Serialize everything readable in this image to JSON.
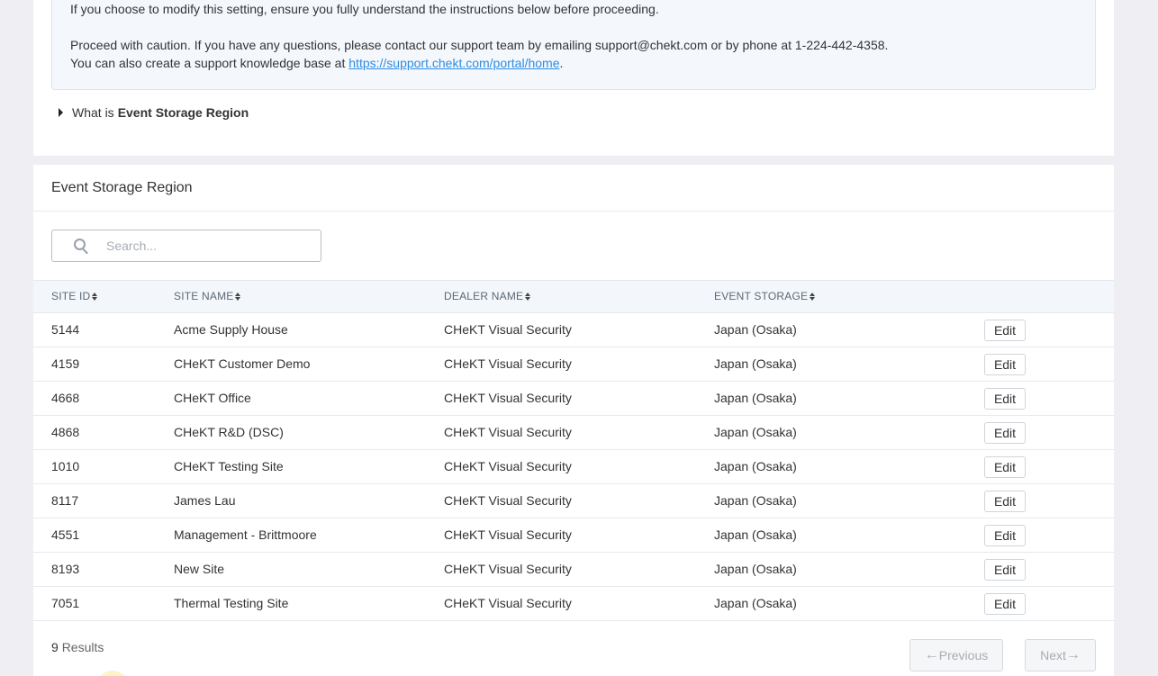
{
  "notice": {
    "line1": "If you choose to modify this setting, ensure you fully understand the instructions below before proceeding.",
    "line2": "Proceed with caution. If you have any questions, please contact our support team by emailing support@chekt.com or by phone at 1-224-442-4358.",
    "line3_prefix": "You can also create a support knowledge base at ",
    "line3_link": "https://support.chekt.com/portal/home",
    "line3_suffix": "."
  },
  "disclosure": {
    "prefix": "What is",
    "bold": "Event Storage Region"
  },
  "panel": {
    "title": "Event Storage Region"
  },
  "search": {
    "placeholder": "Search..."
  },
  "table": {
    "headers": [
      "SITE ID",
      "SITE NAME",
      "DEALER NAME",
      "EVENT STORAGE"
    ],
    "rows": [
      {
        "id": "5144",
        "site": "Acme Supply House",
        "dealer": "CHeKT Visual Security",
        "storage": "Japan (Osaka)",
        "action": "Edit"
      },
      {
        "id": "4159",
        "site": "CHeKT Customer Demo",
        "dealer": "CHeKT Visual Security",
        "storage": "Japan (Osaka)",
        "action": "Edit"
      },
      {
        "id": "4668",
        "site": "CHeKT Office",
        "dealer": "CHeKT Visual Security",
        "storage": "Japan (Osaka)",
        "action": "Edit"
      },
      {
        "id": "4868",
        "site": "CHeKT R&D (DSC)",
        "dealer": "CHeKT Visual Security",
        "storage": "Japan (Osaka)",
        "action": "Edit"
      },
      {
        "id": "1010",
        "site": "CHeKT Testing Site",
        "dealer": "CHeKT Visual Security",
        "storage": "Japan (Osaka)",
        "action": "Edit"
      },
      {
        "id": "8117",
        "site": "James Lau",
        "dealer": "CHeKT Visual Security",
        "storage": "Japan (Osaka)",
        "action": "Edit"
      },
      {
        "id": "4551",
        "site": "Management - Brittmoore",
        "dealer": "CHeKT Visual Security",
        "storage": "Japan (Osaka)",
        "action": "Edit"
      },
      {
        "id": "8193",
        "site": "New Site",
        "dealer": "CHeKT Visual Security",
        "storage": "Japan (Osaka)",
        "action": "Edit"
      },
      {
        "id": "7051",
        "site": "Thermal Testing Site",
        "dealer": "CHeKT Visual Security",
        "storage": "Japan (Osaka)",
        "action": "Edit"
      }
    ]
  },
  "footer": {
    "count": "9",
    "results_label": "Results",
    "previous": "Previous",
    "next": "Next"
  }
}
